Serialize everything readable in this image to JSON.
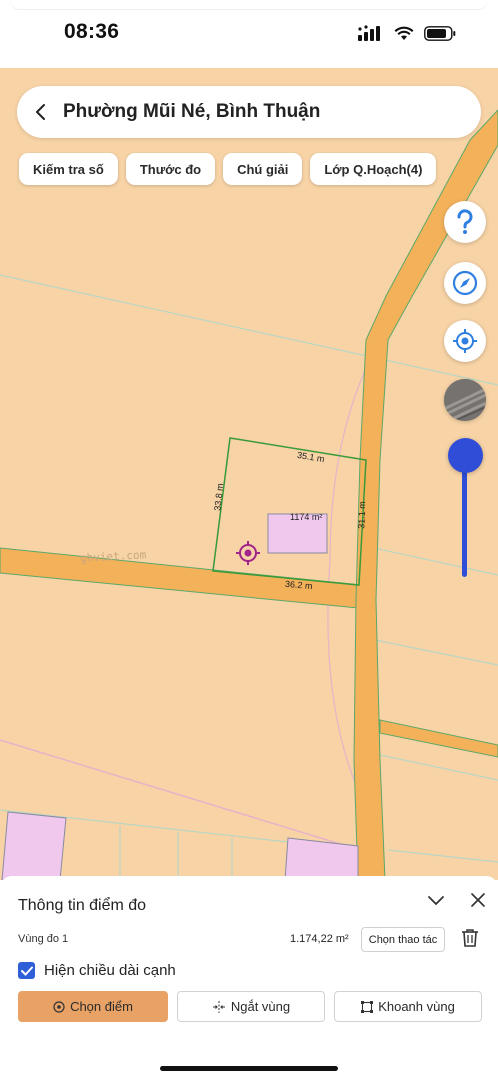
{
  "status": {
    "time": "08:36"
  },
  "header": {
    "title": "Phường Mũi Né, Bình Thuận"
  },
  "chips": [
    {
      "label": "Kiếm tra số"
    },
    {
      "label": "Thước đo"
    },
    {
      "label": "Chú giải"
    },
    {
      "label": "Lớp Q.Hoạch(4)"
    }
  ],
  "map": {
    "watermark": "ghviet.com",
    "edges": {
      "top": "35.1 m",
      "left": "33.8 m",
      "right": "31.1 m",
      "bottom": "36.2 m"
    },
    "building_area": "1174 m²",
    "colors": {
      "background": "#f7d3a6",
      "road": "#f3b15a",
      "parcel_line": "#5aa86a",
      "building": "#f0c8ee",
      "accent": "#2f4dd6",
      "measure_line": "#3a9a3a"
    }
  },
  "controls": {
    "help_icon": "question-icon",
    "compass_icon": "compass-icon",
    "locate_icon": "crosshair-icon",
    "layer_icon": "satellite-layer-icon",
    "zoom_level": 0.14
  },
  "panel": {
    "title": "Thông tin điểm đo",
    "region_label": "Vùng đo 1",
    "region_area": "1.174,22 m²",
    "select_action_label": "Chọn thao tác",
    "checkbox_label": "Hiện chiều dài cạnh",
    "checkbox_checked": true,
    "buttons": {
      "choose_point": "Chọn điểm",
      "split_region": "Ngắt vùng",
      "draw_region": "Khoanh vùng"
    }
  }
}
